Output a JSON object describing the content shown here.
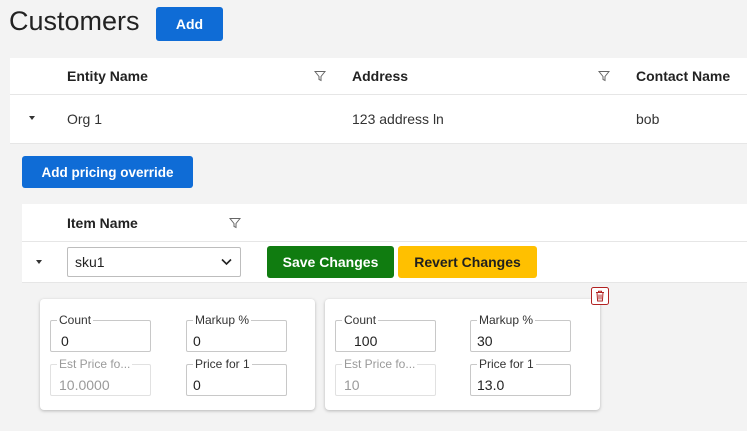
{
  "page": {
    "title": "Customers",
    "add_label": "Add"
  },
  "customers_table": {
    "columns": [
      "Entity Name",
      "Address",
      "Contact Name"
    ],
    "rows": [
      {
        "entity_name": "Org 1",
        "address": "123 address ln",
        "contact_name": "bob"
      }
    ]
  },
  "pricing": {
    "add_override_label": "Add pricing override",
    "column": "Item Name",
    "row": {
      "item_name": "sku1",
      "save_label": "Save Changes",
      "revert_label": "Revert Changes"
    },
    "tiers": [
      {
        "count_label": "Count",
        "count": "0",
        "markup_label": "Markup %",
        "markup": "0",
        "est_label": "Est Price fo...",
        "est": "10.0000",
        "price_label": "Price for 1",
        "price": "0"
      },
      {
        "count_label": "Count",
        "count": "100",
        "markup_label": "Markup %",
        "markup": "30",
        "est_label": "Est Price fo...",
        "est": "10",
        "price_label": "Price for 1",
        "price": "13.0"
      }
    ]
  },
  "icons": {
    "filter": "filter-icon",
    "expand": "caret-down-icon",
    "dropdown": "chevron-down-icon",
    "delete": "trash-icon"
  },
  "colors": {
    "primary": "#0f6cd6",
    "save": "#107c10",
    "revert": "#ffc000",
    "danger": "#b22222"
  }
}
